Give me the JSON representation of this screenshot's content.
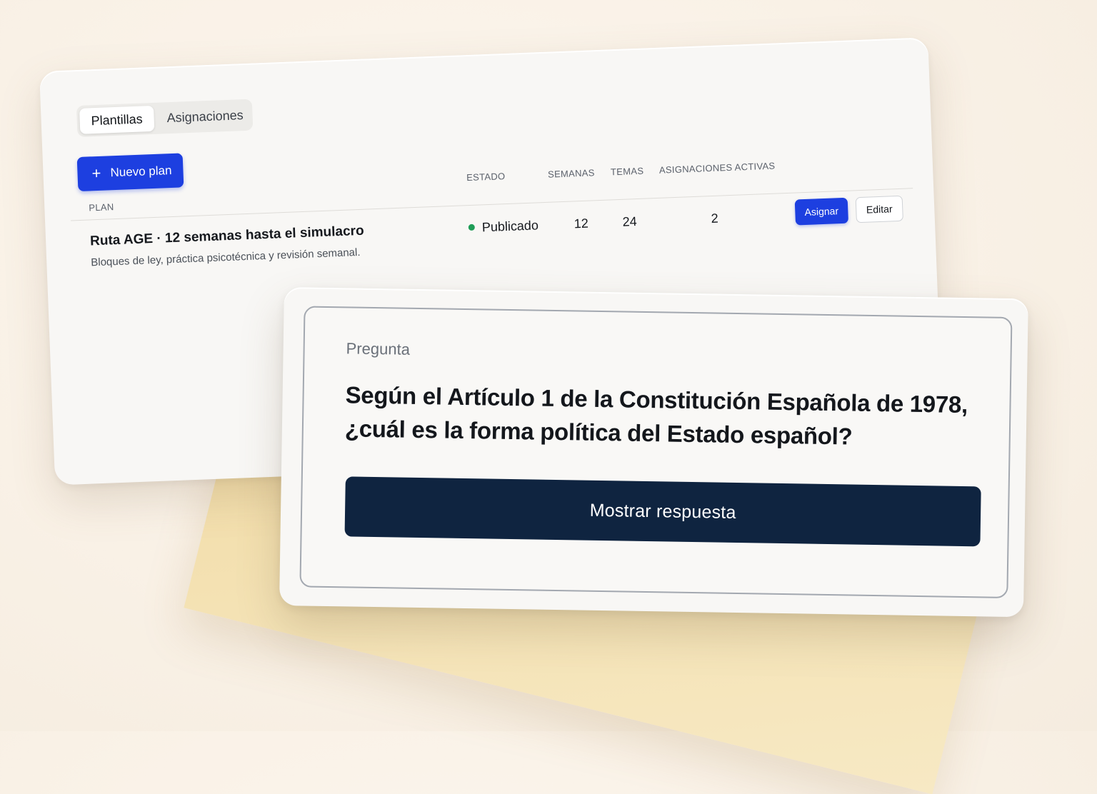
{
  "tabs": [
    {
      "label": "Plantillas",
      "active": true
    },
    {
      "label": "Asignaciones",
      "active": false
    }
  ],
  "new_plan": {
    "icon": "plus-icon",
    "icon_glyph": "+",
    "label": "Nuevo plan"
  },
  "table": {
    "headers": {
      "plan": "PLAN",
      "estado": "ESTADO",
      "semanas": "SEMANAS",
      "temas": "TEMAS",
      "asignaciones": "ASIGNACIONES ACTIVAS"
    },
    "row": {
      "title": "Ruta AGE · 12 semanas hasta el simulacro",
      "subtitle": "Bloques de ley, práctica psicotécnica y revisión semanal.",
      "status": "Publicado",
      "status_color": "#1f9d57",
      "semanas": "12",
      "temas": "24",
      "asignaciones": "2",
      "assign_label": "Asignar",
      "edit_label": "Editar"
    }
  },
  "question_card": {
    "label": "Pregunta",
    "text": "Según el Artículo 1 de la Constitución Española de 1978, ¿cuál es la forma política del Estado español?",
    "button_label": "Mostrar respuesta"
  },
  "colors": {
    "primary": "#1d3fe0",
    "dark_button": "#0f2440",
    "background": "#f9f1e6"
  }
}
